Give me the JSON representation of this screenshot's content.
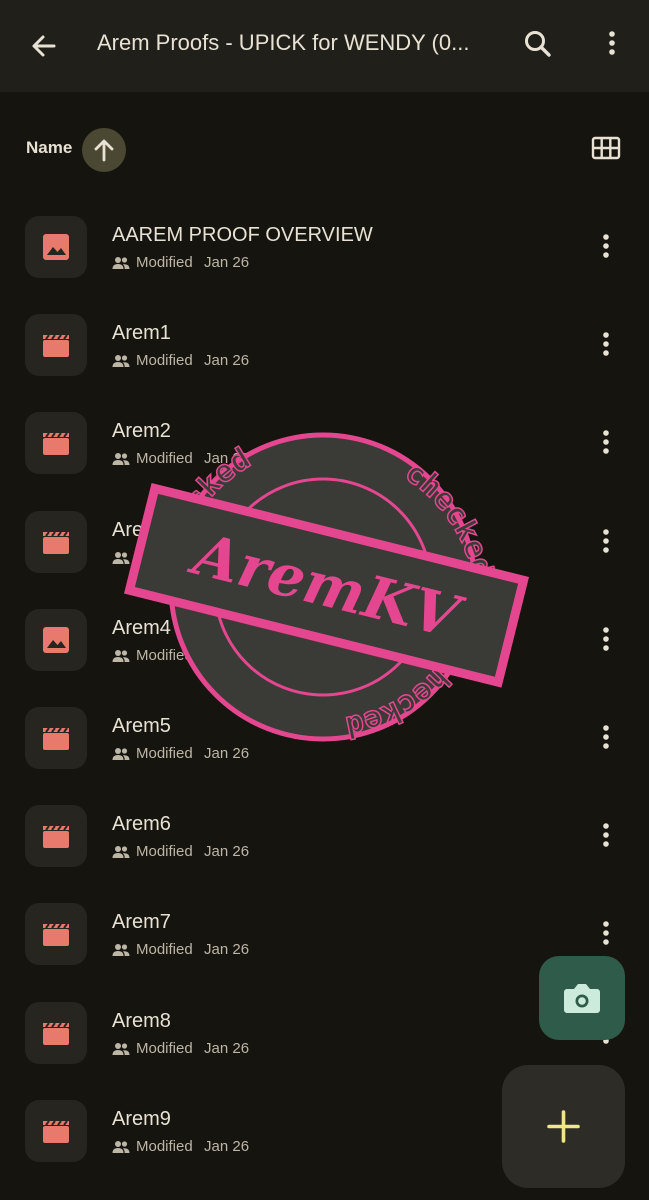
{
  "header": {
    "title": "Arem Proofs - UPICK for WENDY (0..."
  },
  "sort": {
    "label": "Name",
    "direction": "ascending"
  },
  "files": [
    {
      "name": "AAREM PROOF OVERVIEW",
      "type": "image",
      "status": "Modified",
      "date": "Jan 26"
    },
    {
      "name": "Arem1",
      "type": "video",
      "status": "Modified",
      "date": "Jan 26"
    },
    {
      "name": "Arem2",
      "type": "video",
      "status": "Modified",
      "date": "Jan 26"
    },
    {
      "name": "Arem3",
      "type": "video",
      "status": "Modified",
      "date": "Jan 26"
    },
    {
      "name": "Arem4",
      "type": "image",
      "status": "Modified",
      "date": "Jan 26"
    },
    {
      "name": "Arem5",
      "type": "video",
      "status": "Modified",
      "date": "Jan 26"
    },
    {
      "name": "Arem6",
      "type": "video",
      "status": "Modified",
      "date": "Jan 26"
    },
    {
      "name": "Arem7",
      "type": "video",
      "status": "Modified",
      "date": "Jan 26"
    },
    {
      "name": "Arem8",
      "type": "video",
      "status": "Modified",
      "date": "Jan 26"
    },
    {
      "name": "Arem9",
      "type": "video",
      "status": "Modified",
      "date": "Jan 26"
    }
  ],
  "stamp": {
    "title": "AremKV",
    "ring_top": "checked",
    "ring_right": "checked",
    "ring_bottom": "checked"
  },
  "colors": {
    "background": "#15140f",
    "topbar": "#201f1a",
    "icon_red": "#e8796d",
    "stamp_pink": "#e4478f",
    "fab_camera": "#2f5b4a",
    "fab_plus": "#f1e58a"
  }
}
